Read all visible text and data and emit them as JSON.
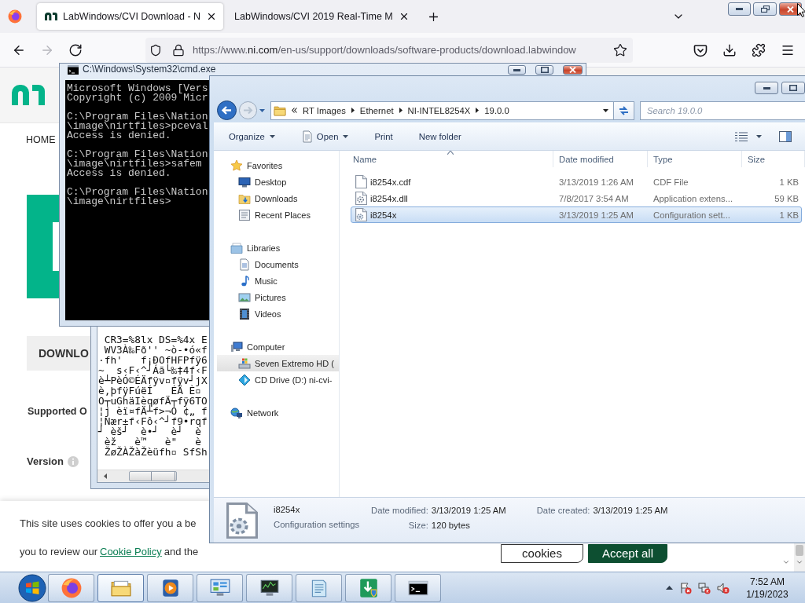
{
  "browser": {
    "tabs": [
      {
        "title": "LabWindows/CVI Download - N",
        "icon": true,
        "selected": true
      },
      {
        "title": "LabWindows/CVI 2019 Real-Time M",
        "icon": false,
        "selected": false
      }
    ],
    "forward_enabled": false,
    "url": {
      "scheme": "https://www.",
      "host": "ni.com",
      "path": "/en-us/support/downloads/software-products/download.labwindow"
    }
  },
  "page": {
    "nav_link": "HOME",
    "download_tab": "DOWNLO",
    "supported_label": "Supported O",
    "version_label": "Version"
  },
  "cookie_banner": {
    "text": "This site uses cookies to offer you a be",
    "review_text": "you to review our",
    "link": "Cookie Policy",
    "after_link": "and the",
    "buttons": [
      {
        "label": "cookies",
        "kind": "outline"
      },
      {
        "label": "Accept all",
        "kind": "primary"
      }
    ]
  },
  "notepad_window": {
    "lines": [
      " CR3=%8lx DS=%4x E",
      " WV3À‰Fð'' ~ò-•ó«f",
      "·fh'   f¡ÐOfHFPfÿ6",
      "~  s‹F‹^┘Áã└‰‡4f‹F",
      "è┴PèÓ©ÉÄfÿv▫fÿv┘jX",
      "è,þfÿFúëÍ   ÉÄ È▫",
      "O┬uGhäIèqøfÄ┬fÿ6TO",
      "¦j èï¤fÄ┴f>¬O ¢„ f",
      "¦Nær±f‹Fô‹^┘f9•rqf",
      "┘ èš┘  è•┘  è┘  è",
      " èž   è™   è\"   è",
      " ŽøŽÀŽàŽèüfh▫ SfSh"
    ]
  },
  "cmd_window": {
    "title": "C:\\Windows\\System32\\cmd.exe",
    "blocks": [
      [
        "Microsoft Windows [Vers",
        "Copyright (c) 2009 Micr"
      ],
      [
        "C:\\Program Files\\Nation",
        "\\image\\nirtfiles>pceval",
        "Access is denied."
      ],
      [
        "C:\\Program Files\\Nation",
        "\\image\\nirtfiles>safem",
        "Access is denied."
      ],
      [
        "C:\\Program Files\\Nation",
        "\\image\\nirtfiles>"
      ]
    ]
  },
  "explorer": {
    "breadcrumb": [
      "RT Images",
      "Ethernet",
      "NI-INTEL8254X",
      "19.0.0"
    ],
    "search": {
      "placeholder": "Search 19.0.0"
    },
    "commands": [
      {
        "label": "Organize",
        "kind": "menu"
      },
      {
        "label": "Open",
        "kind": "open"
      },
      {
        "label": "Print",
        "kind": "plain"
      },
      {
        "label": "New folder",
        "kind": "plain"
      }
    ],
    "nav": [
      {
        "label": "Favorites",
        "kind": "favorites",
        "selected": false,
        "children": [
          {
            "label": "Desktop",
            "kind": "desktop",
            "selected": false
          },
          {
            "label": "Downloads",
            "kind": "downloads",
            "selected": false
          },
          {
            "label": "Recent Places",
            "kind": "recent",
            "selected": false
          }
        ]
      },
      {
        "label": "Libraries",
        "kind": "libraries",
        "selected": false,
        "children": [
          {
            "label": "Documents",
            "kind": "documents",
            "selected": false
          },
          {
            "label": "Music",
            "kind": "music",
            "selected": false
          },
          {
            "label": "Pictures",
            "kind": "pictures",
            "selected": false
          },
          {
            "label": "Videos",
            "kind": "videos",
            "selected": false
          }
        ]
      },
      {
        "label": "Computer",
        "kind": "computer",
        "selected": false,
        "children": [
          {
            "label": "Seven Extremo HD (",
            "kind": "hard-drive",
            "selected": true
          },
          {
            "label": "CD Drive (D:) ni-cvi-",
            "kind": "cd-drive",
            "selected": false
          }
        ]
      },
      {
        "label": "Network",
        "kind": "network",
        "selected": false
      }
    ],
    "columns": [
      {
        "label": "Name",
        "sorted": true
      },
      {
        "label": "Date modified",
        "sorted": false
      },
      {
        "label": "Type",
        "sorted": false
      },
      {
        "label": "Size",
        "sorted": false
      }
    ],
    "files": [
      {
        "name": "i8254x.cdf",
        "modified": "3/13/2019 1:26 AM",
        "type": "CDF File",
        "size": "1 KB",
        "kind": "document",
        "selected": false
      },
      {
        "name": "i8254x.dll",
        "modified": "7/8/2017 3:54 AM",
        "type": "Application extens...",
        "size": "59 KB",
        "kind": "dll",
        "selected": false
      },
      {
        "name": "i8254x",
        "modified": "3/13/2019 1:25 AM",
        "type": "Configuration sett...",
        "size": "1 KB",
        "kind": "settings",
        "selected": true
      }
    ],
    "details": {
      "name": "i8254x",
      "type": "Configuration settings",
      "kind": "settings",
      "fields": [
        {
          "label": "Date modified:",
          "value": "3/13/2019 1:25 AM"
        },
        {
          "label": "Size:",
          "value": "120 bytes"
        },
        {
          "label": "Date created:",
          "value": "3/13/2019 1:25 AM"
        }
      ]
    }
  },
  "taskbar": {
    "apps": [
      {
        "kind": "firefox",
        "active": false
      },
      {
        "kind": "explorer",
        "active": true
      },
      {
        "kind": "media-player",
        "active": false
      },
      {
        "kind": "control-panel",
        "active": false
      },
      {
        "kind": "monitor",
        "active": false
      },
      {
        "kind": "notepad",
        "active": false
      },
      {
        "kind": "installer",
        "active": false
      },
      {
        "kind": "cmd",
        "active": false
      }
    ],
    "time": "7:52 AM",
    "date": "1/19/2023"
  }
}
